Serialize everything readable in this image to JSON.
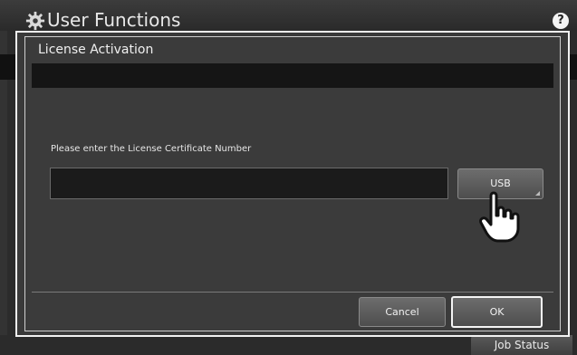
{
  "app": {
    "title": "User Functions",
    "help_glyph": "?",
    "job_status": "Job Status"
  },
  "dialog": {
    "title": "License Activation",
    "prompt": "Please enter the License Certificate Number",
    "license_input_value": "",
    "usb_label": "USB",
    "cancel_label": "Cancel",
    "ok_label": "OK"
  },
  "icons": [
    "gear-icon",
    "help-icon",
    "hand-pointer-icon"
  ],
  "colors": {
    "background": "#2b2b2b",
    "dialog": "#3a3a3a",
    "input": "#1b1b1b",
    "button": "#5e5e5e",
    "text": "#f0f0f0"
  }
}
